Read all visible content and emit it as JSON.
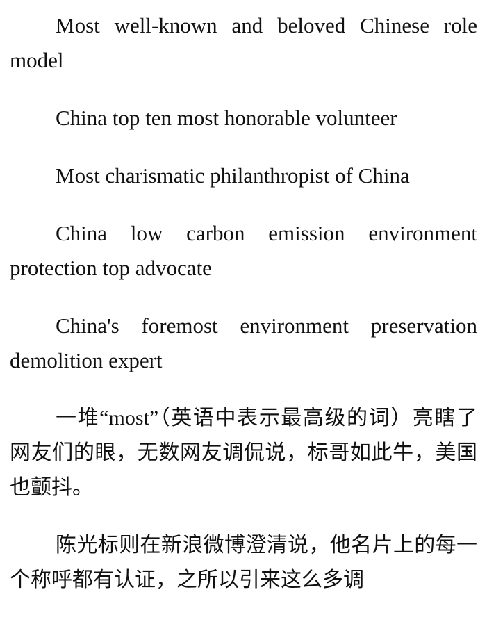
{
  "document": {
    "paragraphs": [
      "Most well-known and beloved Chinese role model",
      "China top ten most honorable volunteer",
      "Most charismatic philanthropist of China",
      "China low carbon emission environment protection top advocate",
      "China's foremost environment preservation demolition expert",
      "一堆“most”（英语中表示最高级的词）亮瞎了网友们的眼，无数网友调侃说，标哥如此牛，美国也颤抖。",
      "陈光标则在新浪微博澄清说，他名片上的每一个称呼都有认证，之所以引来这么多调"
    ]
  }
}
